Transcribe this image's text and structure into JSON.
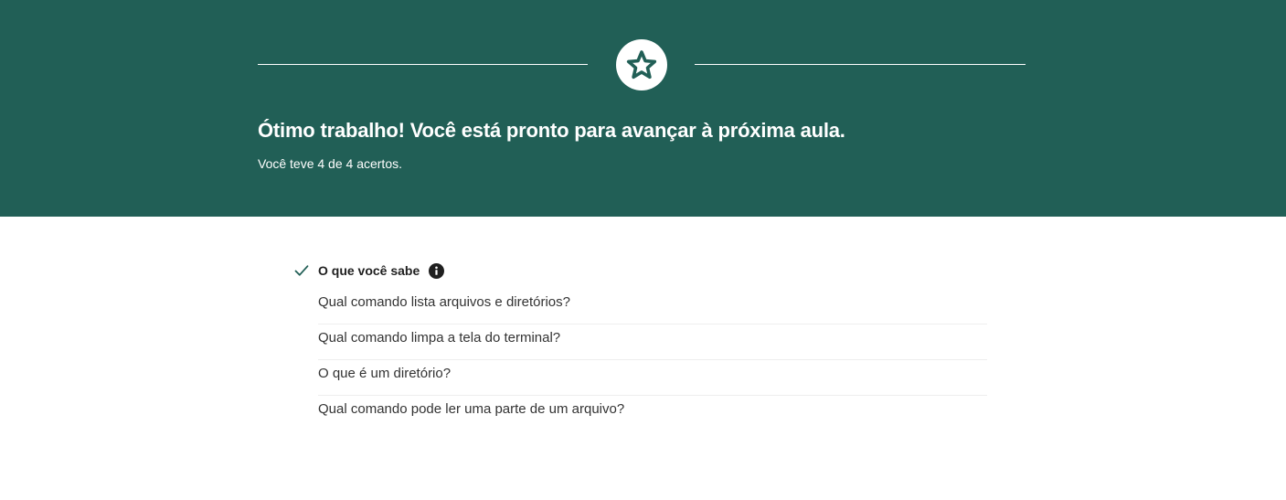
{
  "banner": {
    "headline": "Ótimo trabalho! Você está pronto para avançar à próxima aula.",
    "score_text": "Você teve 4 de 4 acertos.",
    "badge_icon": "star-icon",
    "background_color": "#215f56"
  },
  "section": {
    "status_icon": "check-icon",
    "title": "O que você sabe",
    "info_icon": "info-icon",
    "questions": [
      "Qual comando lista arquivos e diretórios?",
      "Qual comando limpa a tela do terminal?",
      "O que é um diretório?",
      "Qual comando pode ler uma parte de um arquivo?"
    ]
  }
}
